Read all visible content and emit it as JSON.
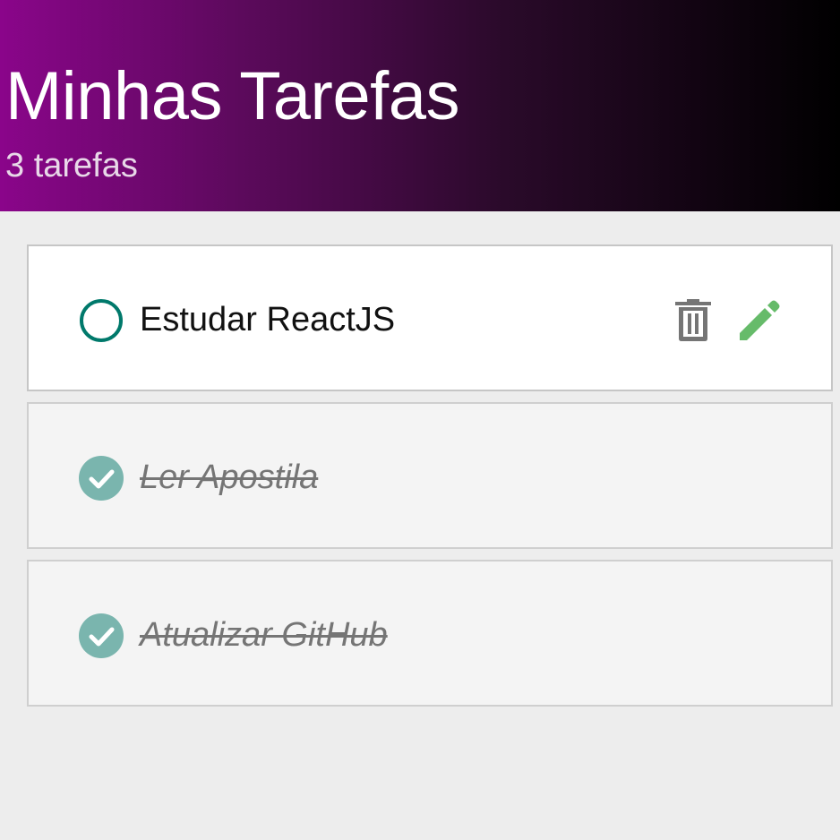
{
  "header": {
    "title": "Minhas Tarefas",
    "subtitle": "3 tarefas"
  },
  "tasks": [
    {
      "label": "Estudar ReactJS",
      "done": false,
      "status_icon": "circle-outline-icon"
    },
    {
      "label": "Ler Apostila",
      "done": true,
      "status_icon": "check-circle-icon"
    },
    {
      "label": "Atualizar GitHub",
      "done": true,
      "status_icon": "check-circle-icon"
    }
  ],
  "actions": {
    "delete_icon": "trash-icon",
    "edit_icon": "pencil-icon"
  },
  "colors": {
    "header_gradient_start": "#8a058a",
    "header_gradient_end": "#000000",
    "pending_circle": "#00796b",
    "done_circle": "#7ab5ae",
    "delete": "#757575",
    "edit": "#66bb6a"
  }
}
